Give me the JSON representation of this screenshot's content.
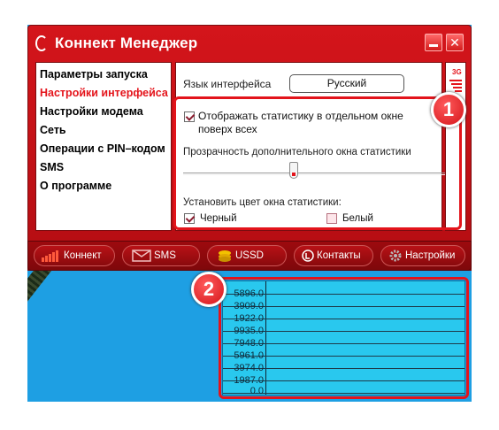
{
  "window": {
    "title": "Коннект Менеджер",
    "minimize_glyph": "",
    "close_glyph": "✕"
  },
  "nav": {
    "items": [
      {
        "label": "Параметры запуска",
        "active": false
      },
      {
        "label": "Настройки интерфейса",
        "active": true
      },
      {
        "label": "Настройки модема",
        "active": false
      },
      {
        "label": "Сеть",
        "active": false
      },
      {
        "label": "Операции с PIN–кодом",
        "active": false
      },
      {
        "label": "SMS",
        "active": false
      },
      {
        "label": "О программе",
        "active": false
      }
    ]
  },
  "settings": {
    "language_label": "Язык интерфейса",
    "language_value": "Русский",
    "show_stats_label": "Отображать статистику в отдельном окне поверх всех",
    "show_stats_checked": true,
    "opacity_label": "Прозрачность дополнительного окна статистики",
    "opacity_value": 0.41,
    "color_label": "Установить цвет окна статистики:",
    "color_black_label": "Черный",
    "color_black_checked": true,
    "color_white_label": "Белый",
    "color_white_checked": false
  },
  "signal": {
    "network": "3G",
    "icon": "signal-icon"
  },
  "toolbar": {
    "buttons": [
      {
        "label": "Коннект",
        "icon": "signal-bars-icon"
      },
      {
        "label": "SMS",
        "icon": "envelope-icon"
      },
      {
        "label": "USSD",
        "icon": "coins-icon"
      },
      {
        "label": "Контакты",
        "icon": "phone-icon"
      },
      {
        "label": "Настройки",
        "icon": "gear-icon"
      }
    ]
  },
  "annotations": {
    "badge_1": "1",
    "badge_2": "2"
  },
  "stats": {
    "values": [
      "5896.0",
      "3909.0",
      "1922.0",
      "9935.0",
      "7948.0",
      "5961.0",
      "3974.0",
      "1987.0",
      "0.0"
    ]
  },
  "colors": {
    "brand_red": "#d4151b",
    "active_nav": "#e4141b",
    "desktop_blue": "#1e9fe3",
    "stats_bg": "#29c8ee"
  }
}
